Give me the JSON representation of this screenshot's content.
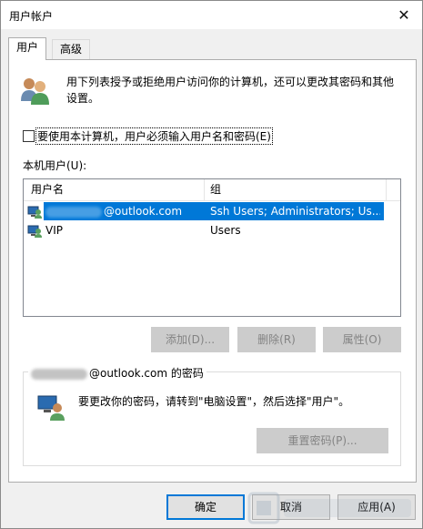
{
  "window": {
    "title": "用户帐户",
    "close_glyph": "✕"
  },
  "tabs": [
    {
      "label": "用户"
    },
    {
      "label": "高级"
    }
  ],
  "intro_text": "用下列表授予或拒绝用户访问你的计算机，还可以更改其密码和其他设置。",
  "require_password_checkbox": {
    "label": "要使用本计算机，用户必须输入用户名和密码(E)",
    "checked": false
  },
  "users_label": "本机用户(U):",
  "users_table": {
    "columns": [
      "用户名",
      "组"
    ],
    "rows": [
      {
        "name": "@outlook.com",
        "group": "Ssh Users; Administrators; Us...",
        "selected": true
      },
      {
        "name": "VIP",
        "group": "Users",
        "selected": false
      }
    ]
  },
  "buttons": {
    "add": "添加(D)...",
    "delete": "删除(R)",
    "properties": "属性(O)"
  },
  "password_group": {
    "title": "@outlook.com 的密码",
    "text": "要更改你的密码，请转到\"电脑设置\"，然后选择\"用户\"。",
    "reset_button": "重置密码(P)..."
  },
  "footer": {
    "ok": "确定",
    "cancel": "取消",
    "apply": "应用(A)"
  },
  "colors": {
    "selection": "#0078d7",
    "accent_border": "#0078d7"
  }
}
